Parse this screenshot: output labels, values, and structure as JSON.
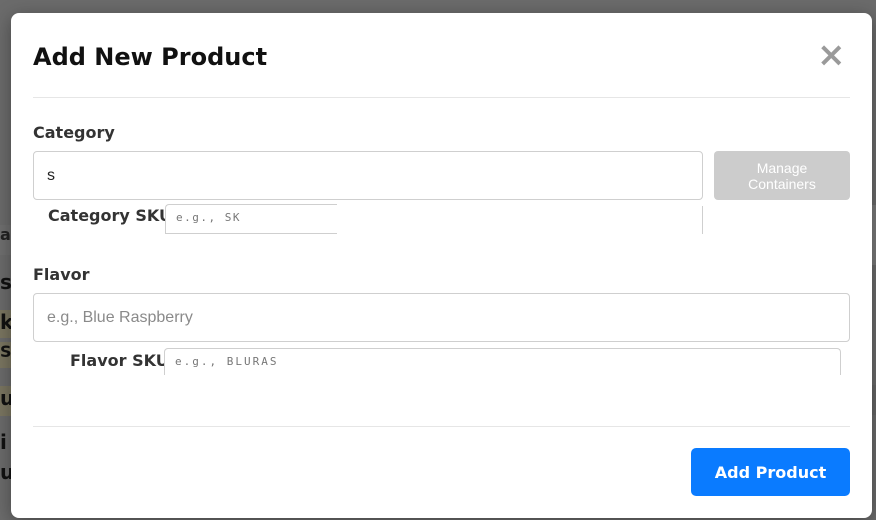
{
  "modal": {
    "title": "Add New Product",
    "close_icon": "close-icon",
    "category": {
      "label": "Category",
      "value": "s",
      "manage_button": "Manage\nContainers",
      "sku_label": "Category SKU",
      "sku_placeholder": "e.g., SK"
    },
    "flavor": {
      "label": "Flavor",
      "placeholder": "e.g., Blue Raspberry",
      "sku_label": "Flavor SKU",
      "sku_placeholder": "e.g., BLURAS"
    },
    "submit_label": "Add Product"
  },
  "background": {
    "partial_glyphs": [
      "s",
      "ki",
      "S",
      "u",
      "i",
      "u",
      "a"
    ]
  },
  "colors": {
    "overlay": "#6b6b6b",
    "primary": "#0a7bff",
    "disabled": "#cccccc"
  }
}
